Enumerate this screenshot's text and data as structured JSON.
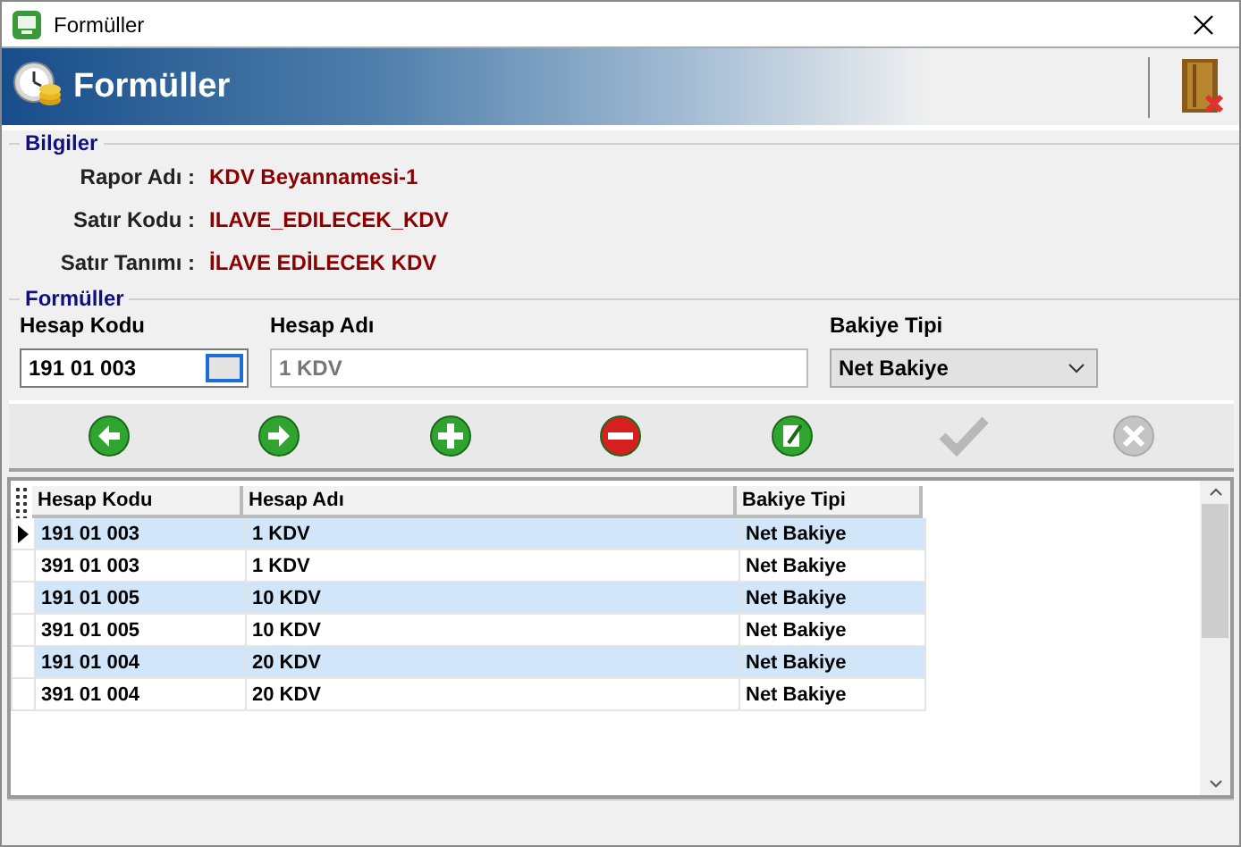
{
  "window": {
    "title": "Formüller"
  },
  "header": {
    "title": "Formüller"
  },
  "info": {
    "legend": "Bilgiler",
    "fields": [
      {
        "label": "Rapor Adı :",
        "value": "KDV Beyannamesi-1"
      },
      {
        "label": "Satır Kodu :",
        "value": "ILAVE_EDILECEK_KDV"
      },
      {
        "label": "Satır Tanımı :",
        "value": "İLAVE EDİLECEK KDV"
      }
    ]
  },
  "form": {
    "legend": "Formüller",
    "code_label": "Hesap Kodu",
    "code_value": "191 01 003",
    "name_label": "Hesap Adı",
    "name_value": "1 KDV",
    "type_label": "Bakiye Tipi",
    "type_value": "Net Bakiye"
  },
  "toolbar": [
    {
      "kind": "back",
      "disabled": false
    },
    {
      "kind": "forward",
      "disabled": false
    },
    {
      "kind": "add",
      "disabled": false
    },
    {
      "kind": "remove",
      "disabled": false
    },
    {
      "kind": "edit",
      "disabled": false
    },
    {
      "kind": "confirm",
      "disabled": true
    },
    {
      "kind": "cancel",
      "disabled": true
    }
  ],
  "table": {
    "columns": [
      "Hesap Kodu",
      "Hesap Adı",
      "Bakiye Tipi"
    ],
    "rows": [
      {
        "cells": [
          "191 01 003",
          "1 KDV",
          "Net Bakiye"
        ],
        "current": true
      },
      {
        "cells": [
          "391 01 003",
          "1 KDV",
          "Net Bakiye"
        ],
        "current": false
      },
      {
        "cells": [
          "191 01 005",
          "10 KDV",
          "Net Bakiye"
        ],
        "current": false
      },
      {
        "cells": [
          "391 01 005",
          "10 KDV",
          "Net Bakiye"
        ],
        "current": false
      },
      {
        "cells": [
          "191 01 004",
          "20 KDV",
          "Net Bakiye"
        ],
        "current": false
      },
      {
        "cells": [
          "391 01 004",
          "20 KDV",
          "Net Bakiye"
        ],
        "current": false
      }
    ]
  }
}
